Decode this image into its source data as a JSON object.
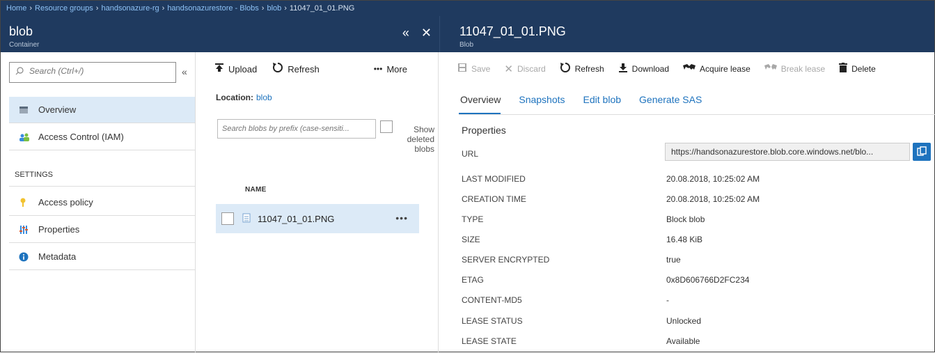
{
  "breadcrumb": [
    {
      "label": "Home"
    },
    {
      "label": "Resource groups"
    },
    {
      "label": "handsonazure-rg"
    },
    {
      "label": "handsonazurestore - Blobs"
    },
    {
      "label": "blob"
    },
    {
      "label": "11047_01_01.PNG"
    }
  ],
  "blade_container": {
    "title": "blob",
    "subtitle": "Container",
    "collapse_glyph": "«",
    "close_glyph": "✕"
  },
  "blade_blob": {
    "title": "11047_01_01.PNG",
    "subtitle": "Blob"
  },
  "leftmenu": {
    "search_placeholder": "Search (Ctrl+/)",
    "collapse_glyph": "«",
    "items": [
      {
        "label": "Overview",
        "icon": "overview-icon",
        "selected": true
      },
      {
        "label": "Access Control (IAM)",
        "icon": "users-icon",
        "selected": false
      }
    ],
    "settings_heading": "SETTINGS",
    "settings_items": [
      {
        "label": "Access policy",
        "icon": "key-icon"
      },
      {
        "label": "Properties",
        "icon": "sliders-icon"
      },
      {
        "label": "Metadata",
        "icon": "info-icon"
      }
    ]
  },
  "middle": {
    "toolbar": {
      "upload": "Upload",
      "refresh": "Refresh",
      "more": "More"
    },
    "location_label": "Location:",
    "location_value": "blob",
    "prefix_placeholder": "Search blobs by prefix (case-sensiti...",
    "show_deleted": "Show deleted blobs",
    "name_header": "NAME",
    "files": [
      {
        "name": "11047_01_01.PNG"
      }
    ]
  },
  "right": {
    "toolbar": {
      "save": "Save",
      "discard": "Discard",
      "refresh": "Refresh",
      "download": "Download",
      "acquire_lease": "Acquire lease",
      "break_lease": "Break lease",
      "delete": "Delete"
    },
    "tabs": [
      "Overview",
      "Snapshots",
      "Edit blob",
      "Generate SAS"
    ],
    "properties_title": "Properties",
    "url_label": "URL",
    "url_value": "https://handsonazurestore.blob.core.windows.net/blo...",
    "properties": [
      {
        "label": "LAST MODIFIED",
        "value": "20.08.2018, 10:25:02 AM"
      },
      {
        "label": "CREATION TIME",
        "value": "20.08.2018, 10:25:02 AM"
      },
      {
        "label": "TYPE",
        "value": "Block blob"
      },
      {
        "label": "SIZE",
        "value": "16.48 KiB"
      },
      {
        "label": "SERVER ENCRYPTED",
        "value": "true"
      },
      {
        "label": "ETAG",
        "value": "0x8D606766D2FC234"
      },
      {
        "label": "CONTENT-MD5",
        "value": "-"
      },
      {
        "label": "LEASE STATUS",
        "value": "Unlocked"
      },
      {
        "label": "LEASE STATE",
        "value": "Available"
      }
    ]
  },
  "colors": {
    "header_bg": "#1f3a5f",
    "accent": "#1e73be",
    "selected_bg": "#dceaf7"
  }
}
